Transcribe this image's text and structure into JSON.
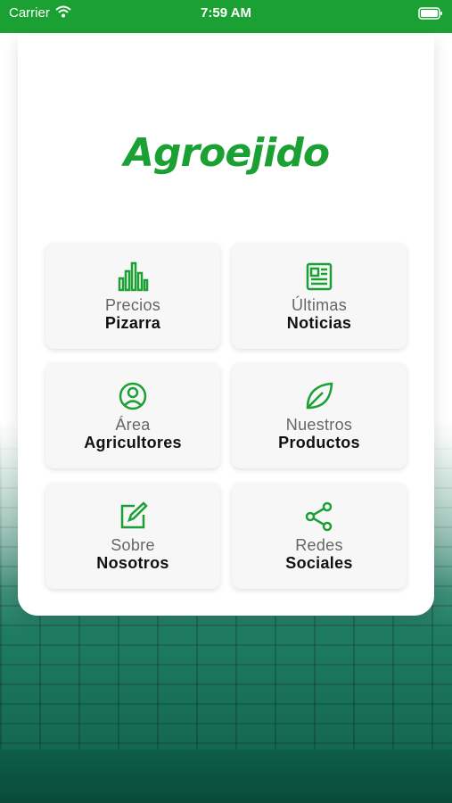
{
  "status_bar": {
    "carrier": "Carrier",
    "time": "7:59 AM"
  },
  "app": {
    "logo_text": "Agroejido",
    "brand_color": "#1aa033"
  },
  "menu": [
    {
      "line1": "Precios",
      "line2": "Pizarra",
      "icon": "bar-chart-icon"
    },
    {
      "line1": "Últimas",
      "line2": "Noticias",
      "icon": "newspaper-icon"
    },
    {
      "line1": "Área",
      "line2": "Agricultores",
      "icon": "user-circle-icon"
    },
    {
      "line1": "Nuestros",
      "line2": "Productos",
      "icon": "leaf-icon"
    },
    {
      "line1": "Sobre",
      "line2": "Nosotros",
      "icon": "edit-icon"
    },
    {
      "line1": "Redes",
      "line2": "Sociales",
      "icon": "share-icon"
    }
  ]
}
